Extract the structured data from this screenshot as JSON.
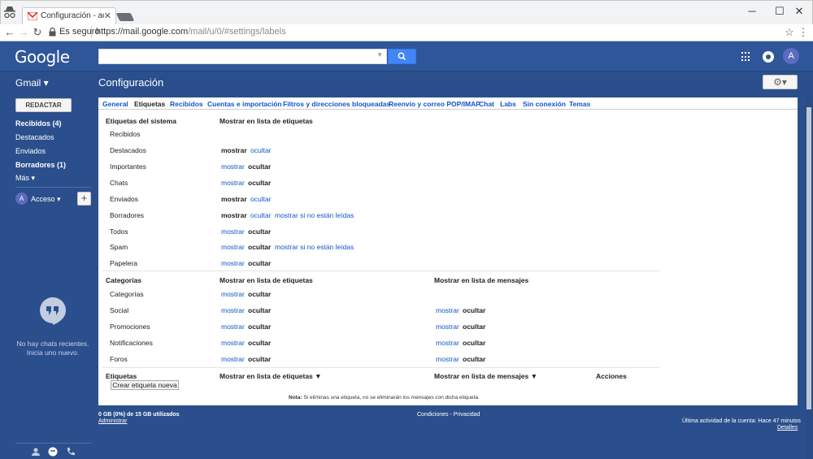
{
  "browser": {
    "tab_title": "Configuración - acceso",
    "secure_label": "Es seguro",
    "url_host": "https://mail.google.com",
    "url_path": "/mail/u/0/#settings/labels"
  },
  "header": {
    "logo": "Google",
    "avatar_letter": "A"
  },
  "subheader": {
    "gmail_label": "Gmail ▾",
    "page_title": "Configuración",
    "settings_btn": "⚙▾"
  },
  "sidebar": {
    "compose": "REDACTAR",
    "items": [
      {
        "label": "Recibidos (4)"
      },
      {
        "label": "Destacados"
      },
      {
        "label": "Enviados"
      },
      {
        "label": "Borradores (1)"
      },
      {
        "label": "Más ▾"
      }
    ],
    "account_letter": "A",
    "account_label": "Acceso ▾",
    "plus": "+",
    "no_chats": "No hay chats recientes.",
    "start_one": "Inicia uno nuevo."
  },
  "tabs": [
    {
      "label": "General"
    },
    {
      "label": "Etiquetas"
    },
    {
      "label": "Recibidos"
    },
    {
      "label": "Cuentas e importación"
    },
    {
      "label": "Filtros y direcciones bloqueadas"
    },
    {
      "label": "Reenvío y correo POP/IMAP"
    },
    {
      "label": "Chat"
    },
    {
      "label": "Labs"
    },
    {
      "label": "Sin conexión"
    },
    {
      "label": "Temas"
    }
  ],
  "system": {
    "header": "Etiquetas del sistema",
    "col_header": "Mostrar en lista de etiquetas",
    "rows": [
      {
        "name": "Recibidos"
      },
      {
        "name": "Destacados",
        "a": "mostrar",
        "b": "ocultar"
      },
      {
        "name": "Importantes",
        "a": "mostrar",
        "b": "ocultar"
      },
      {
        "name": "Chats",
        "a": "mostrar",
        "b": "ocultar"
      },
      {
        "name": "Enviados",
        "a": "mostrar",
        "b": "ocultar"
      },
      {
        "name": "Borradores",
        "a": "mostrar",
        "b": "ocultar",
        "c": "mostrar si no están leídas"
      },
      {
        "name": "Todos",
        "a": "mostrar",
        "b": "ocultar"
      },
      {
        "name": "Spam",
        "a": "mostrar",
        "b": "ocultar",
        "c": "mostrar si no están leídas"
      },
      {
        "name": "Papelera",
        "a": "mostrar",
        "b": "ocultar"
      }
    ]
  },
  "categories": {
    "header": "Categorías",
    "col1": "Mostrar en lista de etiquetas",
    "col2": "Mostrar en lista de mensajes",
    "rows": [
      {
        "name": "Categorías",
        "a": "mostrar",
        "b": "ocultar"
      },
      {
        "name": "Social",
        "a": "mostrar",
        "b": "ocultar",
        "c": "mostrar",
        "d": "ocultar"
      },
      {
        "name": "Promociones",
        "a": "mostrar",
        "b": "ocultar",
        "c": "mostrar",
        "d": "ocultar"
      },
      {
        "name": "Notificaciones",
        "a": "mostrar",
        "b": "ocultar",
        "c": "mostrar",
        "d": "ocultar"
      },
      {
        "name": "Foros",
        "a": "mostrar",
        "b": "ocultar",
        "c": "mostrar",
        "d": "ocultar"
      }
    ]
  },
  "labels": {
    "header": "Etiquetas",
    "col1": "Mostrar en lista de etiquetas ▼",
    "col2": "Mostrar en lista de mensajes ▼",
    "col3": "Acciones",
    "create": "Crear etiqueta nueva",
    "note_bold": "Nota:",
    "note": " Si eliminas una etiqueta, no se eliminarán los mensajes con dicha etiqueta."
  },
  "footer": {
    "storage": "0 GB (0%) de 15 GB utilizados",
    "manage": "Administrar",
    "terms": "Condiciones",
    "sep": " - ",
    "privacy": "Privacidad",
    "activity": "Última actividad de la cuenta: Hace 47 minutos",
    "details": "Detalles"
  },
  "colors": {
    "gmail_blue": "#2f5699",
    "link": "#1155cc",
    "search_blue": "#4285f4"
  }
}
